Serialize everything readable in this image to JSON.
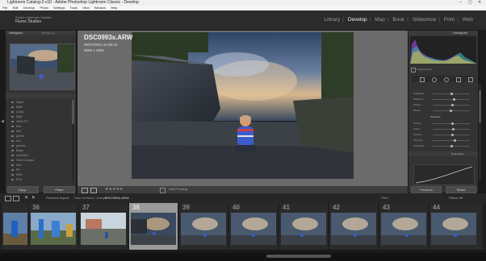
{
  "window": {
    "title": "Lightroom Catalog-2-v10 - Adobe Photoshop Lightroom Classic - Develop",
    "controls": [
      "–",
      "▢",
      "✕"
    ]
  },
  "menu": [
    "File",
    "Edit",
    "Develop",
    "Photo",
    "Settings",
    "Tools",
    "View",
    "Window",
    "Help"
  ],
  "identity": {
    "line1": "Adobe Lightroom Classic",
    "line2": "Flume Studios"
  },
  "modules": [
    {
      "label": "Library",
      "active": false
    },
    {
      "label": "Develop",
      "active": true
    },
    {
      "label": "Map",
      "active": false
    },
    {
      "label": "Book",
      "active": false
    },
    {
      "label": "Slideshow",
      "active": false
    },
    {
      "label": "Print",
      "active": false
    },
    {
      "label": "Web",
      "active": false
    }
  ],
  "left_panel": {
    "navigator_title": "Navigator",
    "navigator_zoom": "FIT  FILL  1:1",
    "presets": [
      "Sepia",
      "B&W",
      "Looks",
      "Style",
      "200% FIT",
      "Flat",
      "Mid",
      "gentle",
      "rich",
      "gannes",
      "Bright",
      "soft B&W",
      "Vivid Contrast",
      "Xtra",
      "PP",
      "NFM",
      "RLB",
      "PP3",
      "shade",
      "Vivid"
    ],
    "copy_button": "Copy...",
    "paste_button": "Paste"
  },
  "photo_info": {
    "filename": "DSC0993s.ARW",
    "datetime": "05/07/2021 20:38:16",
    "dimensions": "6000 x 4000"
  },
  "toolbar": {
    "soft_proofing": "Soft Proofing"
  },
  "right_panel": {
    "histogram_title": "Histogram",
    "original_photo": "Original Photo",
    "basic_labels": [
      "Highlights",
      "Shadows",
      "Whites",
      "Blacks",
      "Texture",
      "Clarity",
      "Dehaze",
      "Vibrance",
      "Saturation"
    ],
    "presence_title": "Presence",
    "tone_curve_title": "Tone Curve",
    "previous_button": "Previous",
    "reset_button": "Reset"
  },
  "filmstrip_bar": {
    "source_label": "Previous Import",
    "path": "Holz Gerbera / Joseph",
    "filename": "DSC0993s.ARW",
    "filter_label": "Filter :",
    "filter_value": "Filters Off"
  },
  "filmstrip": {
    "numbers": [
      "",
      "36",
      "37",
      "38",
      "39",
      "40",
      "41",
      "42",
      "43",
      "44"
    ],
    "selected_index": 3
  }
}
